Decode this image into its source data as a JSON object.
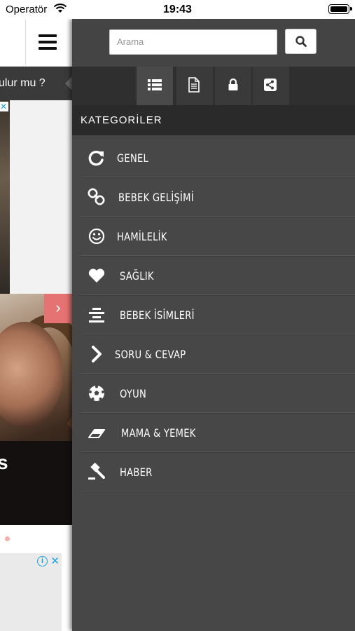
{
  "status_bar": {
    "carrier": "Operatör",
    "time": "19:43"
  },
  "main_page": {
    "ticker_text": "ulur mu ?"
  },
  "drawer": {
    "search": {
      "placeholder": "Arama"
    },
    "section_title": "KATEGORİLER",
    "tabs": [
      {
        "icon": "list-icon",
        "active": true
      },
      {
        "icon": "document-icon",
        "active": false
      },
      {
        "icon": "lock-icon",
        "active": false
      },
      {
        "icon": "share-icon",
        "active": false
      }
    ],
    "categories": [
      {
        "label": "GENEL",
        "icon": "refresh-icon"
      },
      {
        "label": "BEBEK GELİŞİMİ",
        "icon": "link-icon"
      },
      {
        "label": "HAMİLELİK",
        "icon": "smile-icon"
      },
      {
        "label": "SAĞLIK",
        "icon": "heart-icon"
      },
      {
        "label": "BEBEK İSİMLERİ",
        "icon": "align-center-icon"
      },
      {
        "label": "SORU & CEVAP",
        "icon": "chevron-right-icon"
      },
      {
        "label": "OYUN",
        "icon": "soccer-ball-icon"
      },
      {
        "label": "MAMA & YEMEK",
        "icon": "eraser-icon"
      },
      {
        "label": "HABER",
        "icon": "gavel-icon"
      }
    ]
  },
  "colors": {
    "drawer_bg": "#474747",
    "header_bg": "#2a2a2a",
    "accent_next": "#e57373",
    "ad_blue": "#1aa0e0"
  }
}
